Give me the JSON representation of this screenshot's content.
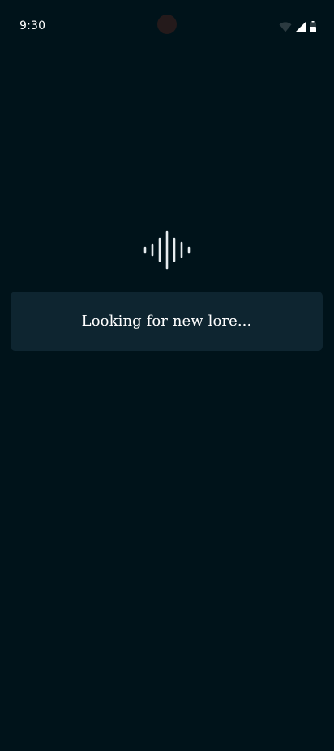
{
  "status_bar": {
    "time": "9:30",
    "icons": [
      "wifi-icon",
      "cellular-signal-icon",
      "battery-icon"
    ]
  },
  "loading": {
    "icon": "audio-waveform-icon",
    "message": "Looking for new lore..."
  },
  "colors": {
    "background": "#00131a",
    "card": "#0e2530",
    "text": "#ffffff",
    "waveform": "#e6ecef"
  }
}
